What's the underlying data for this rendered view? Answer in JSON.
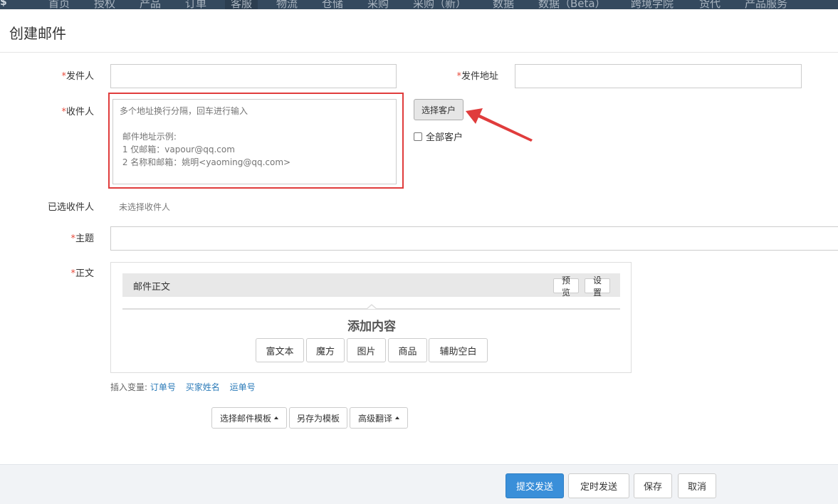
{
  "nav": {
    "logo": "$",
    "items": [
      "首页",
      "授权",
      "产品",
      "订单",
      "客服",
      "物流",
      "仓储",
      "采购",
      "采购（新）",
      "数据",
      "数据（Beta）",
      "跨境学院",
      "货代",
      "产品服务"
    ]
  },
  "page_title": "创建邮件",
  "required_mark": "*",
  "form": {
    "sender_label": "发件人",
    "sender_value": "",
    "sender_address_label": "发件地址",
    "sender_address_value": "",
    "recipient_label": "收件人",
    "recipient_placeholder": "多个地址换行分隔，回车进行输入\n\n 邮件地址示例:\n 1 仅邮箱：vapour@qq.com\n 2 名称和邮箱：姚明<yaoming@qq.com>",
    "select_customer_button": "选择客户",
    "all_customers_label": "全部客户",
    "all_customers_checked": false,
    "selected_recipients_label": "已选收件人",
    "selected_recipients_value": "未选择收件人",
    "subject_label": "主题",
    "subject_value": "",
    "body_label": "正文"
  },
  "editor": {
    "bar_title": "邮件正文",
    "preview_button": "预览",
    "settings_button": "设置",
    "add_content_title": "添加内容",
    "content_buttons": [
      "富文本",
      "魔方",
      "图片",
      "商品",
      "辅助空白"
    ]
  },
  "variables": {
    "label": "插入变量:",
    "items": [
      "订单号",
      "买家姓名",
      "运单号"
    ]
  },
  "template_actions": {
    "select_template": "选择邮件模板",
    "save_as_template": "另存为模板",
    "advanced_translate": "高级翻译"
  },
  "footer": {
    "submit": "提交发送",
    "schedule": "定时发送",
    "save": "保存",
    "cancel": "取消"
  },
  "colors": {
    "primary": "#3a8fd9",
    "required": "#e84c3d",
    "highlight": "#e03c3c",
    "link": "#2a7ab8"
  }
}
